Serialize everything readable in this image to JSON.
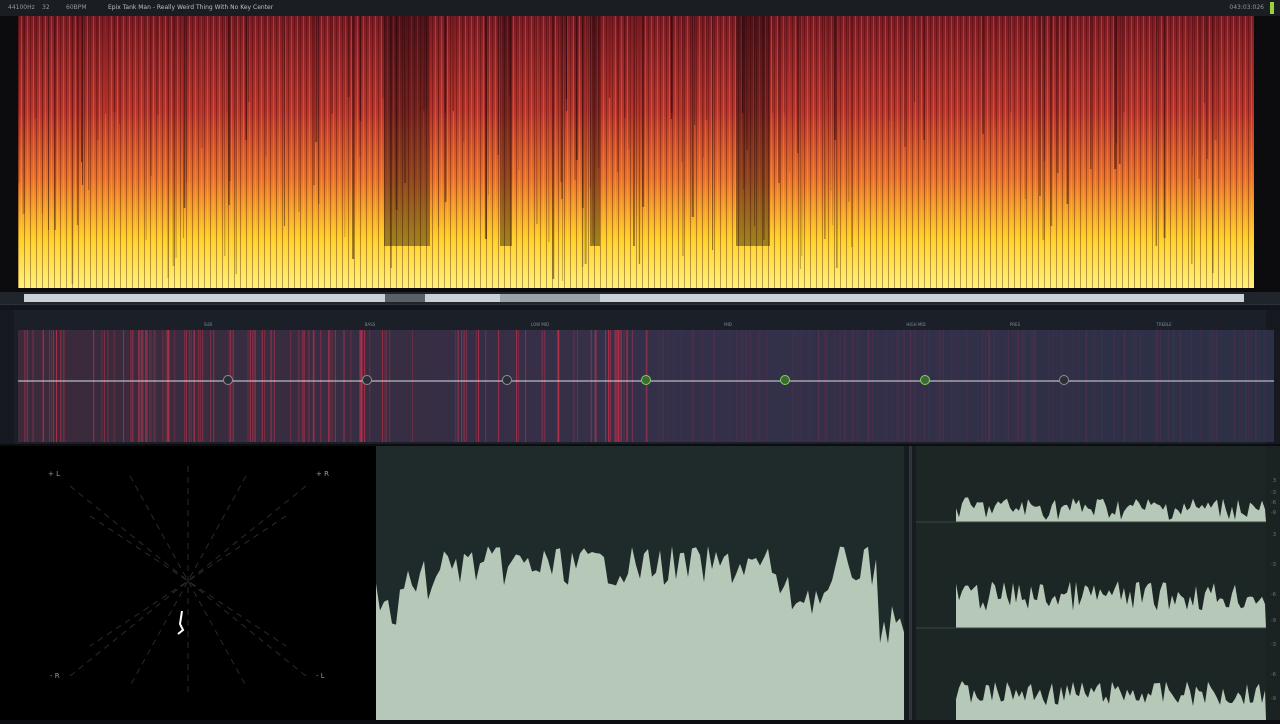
{
  "topbar": {
    "sample_rate": "44100Hz",
    "bit_depth": "32",
    "tempo": "60BPM",
    "track_title": "Epix Tank Man - Really Weird Thing With No Key Center",
    "time": "043:03:026"
  },
  "eq": {
    "band_labels": [
      "SUB",
      "BASS",
      "LOW MID",
      "MID",
      "HIGH MID",
      "PRES",
      "TREBLE"
    ],
    "nodes": [
      {
        "active": false
      },
      {
        "active": false
      },
      {
        "active": false
      },
      {
        "active": true
      },
      {
        "active": true
      },
      {
        "active": true
      },
      {
        "active": false
      }
    ]
  },
  "goniometer": {
    "labels": {
      "top_left": "+ L",
      "top_right": "+ R",
      "bottom_left": "- R",
      "bottom_right": "- L"
    }
  },
  "meter": {
    "scale_top": [
      "3",
      "-3",
      "-6",
      "-9",
      "-12",
      "-18"
    ],
    "scale_mid": [
      "3",
      "-3",
      "-6",
      "-9"
    ],
    "scale_bot": [
      "-3",
      "-6",
      "-9",
      "-6"
    ]
  },
  "colors": {
    "accent": "#9bd13a",
    "spectrogram_low": "#ffea2a",
    "spectrogram_high": "#7a1a22",
    "waveform_fill": "#b6c9b8",
    "eq_node_on": "#7fd45a"
  }
}
